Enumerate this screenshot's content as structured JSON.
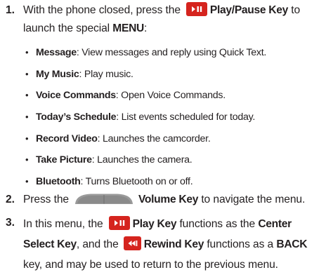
{
  "steps": [
    {
      "num": "1.",
      "pre": "With the phone closed, press the",
      "key": "Play/Pause Key",
      "mid": "to launch the special",
      "menu": "MENU",
      "post": ":"
    },
    {
      "num": "2.",
      "pre": "Press the",
      "key": "Volume Key",
      "post": "to navigate the menu."
    },
    {
      "num": "3.",
      "pre": "In this menu, the",
      "key1": "Play Key",
      "mid1": "functions as the",
      "center": "Center Select Key",
      "mid2": ", and the",
      "key2": "Rewind Key",
      "mid3": "functions as a",
      "back": "BACK",
      "post": "key, and may be used to return to the previous menu."
    }
  ],
  "bullets": [
    {
      "term": "Message",
      "desc": ": View messages and reply using Quick Text."
    },
    {
      "term": "My Music",
      "desc": ": Play music."
    },
    {
      "term": "Voice Commands",
      "desc": ": Open Voice Commands."
    },
    {
      "term": "Today’s Schedule",
      "desc": ": List events scheduled for today."
    },
    {
      "term": "Record Video",
      "desc": ": Launches the camcorder."
    },
    {
      "term": "Take Picture",
      "desc": ": Launches the camera."
    },
    {
      "term": "Bluetooth",
      "desc": ": Turns Bluetooth on or off."
    }
  ],
  "bullet_glyph": "•",
  "icons": {
    "play_pause": "play-pause-key-icon",
    "volume": "volume-key-icon",
    "play": "play-key-icon",
    "rewind": "rewind-key-icon"
  },
  "colors": {
    "key_red": "#d5241e",
    "text": "#231f20"
  }
}
